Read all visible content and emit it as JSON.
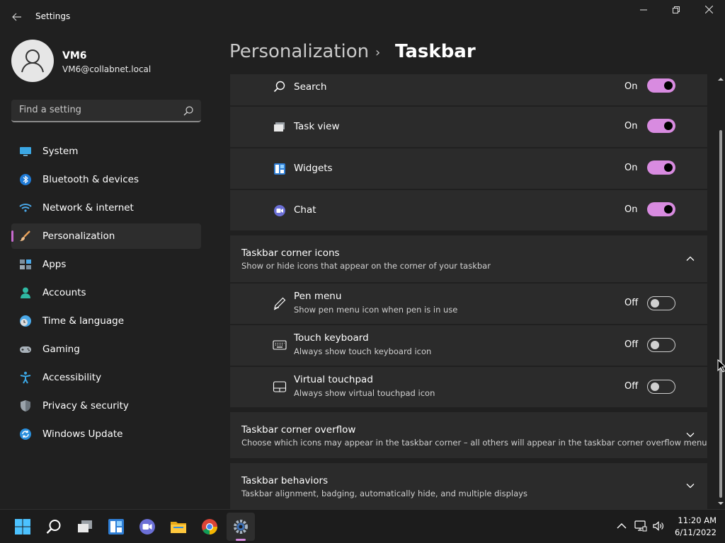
{
  "window": {
    "title": "Settings",
    "back_icon": "arrow-left-icon",
    "minimize_icon": "minimize-icon",
    "maximize_icon": "restore-icon",
    "close_icon": "close-icon"
  },
  "profile": {
    "name": "VM6",
    "email": "VM6@collabnet.local",
    "avatar_icon": "person-icon"
  },
  "search": {
    "placeholder": "Find a setting",
    "icon": "search-icon"
  },
  "sidebar": {
    "items": [
      {
        "label": "System",
        "icon": "monitor-icon"
      },
      {
        "label": "Bluetooth & devices",
        "icon": "bluetooth-icon"
      },
      {
        "label": "Network & internet",
        "icon": "wifi-icon"
      },
      {
        "label": "Personalization",
        "icon": "brush-icon"
      },
      {
        "label": "Apps",
        "icon": "apps-icon"
      },
      {
        "label": "Accounts",
        "icon": "person-icon"
      },
      {
        "label": "Time & language",
        "icon": "clock-globe-icon"
      },
      {
        "label": "Gaming",
        "icon": "gamepad-icon"
      },
      {
        "label": "Accessibility",
        "icon": "accessibility-icon"
      },
      {
        "label": "Privacy & security",
        "icon": "shield-icon"
      },
      {
        "label": "Windows Update",
        "icon": "update-icon"
      }
    ],
    "selected": "Personalization"
  },
  "header": {
    "parent": "Personalization",
    "separator": "›",
    "current": "Taskbar"
  },
  "taskbar_items": [
    {
      "title": "Search",
      "state": "On",
      "icon": "search-icon"
    },
    {
      "title": "Task view",
      "state": "On",
      "icon": "task-view-icon"
    },
    {
      "title": "Widgets",
      "state": "On",
      "icon": "widgets-icon"
    },
    {
      "title": "Chat",
      "state": "On",
      "icon": "chat-icon"
    }
  ],
  "corner_icons": {
    "title": "Taskbar corner icons",
    "subtitle": "Show or hide icons that appear on the corner of your taskbar",
    "icon": "chevron-up-icon",
    "items": [
      {
        "title": "Pen menu",
        "subtitle": "Show pen menu icon when pen is in use",
        "state": "Off",
        "icon": "pen-icon"
      },
      {
        "title": "Touch keyboard",
        "subtitle": "Always show touch keyboard icon",
        "state": "Off",
        "icon": "keyboard-icon"
      },
      {
        "title": "Virtual touchpad",
        "subtitle": "Always show virtual touchpad icon",
        "state": "Off",
        "icon": "touchpad-icon"
      }
    ]
  },
  "corner_overflow": {
    "title": "Taskbar corner overflow",
    "subtitle": "Choose which icons may appear in the taskbar corner – all others will appear in the taskbar corner overflow menu",
    "icon": "chevron-down-icon"
  },
  "behaviors": {
    "title": "Taskbar behaviors",
    "subtitle": "Taskbar alignment, badging, automatically hide, and multiple displays",
    "icon": "chevron-down-icon"
  },
  "system_taskbar": {
    "apps": [
      "start-icon",
      "search-icon",
      "task-view-icon",
      "widgets-icon",
      "chat-icon",
      "file-explorer-icon",
      "chrome-icon",
      "settings-icon"
    ],
    "active_app": "settings-icon",
    "tray": [
      "chevron-up-icon",
      "network-icon",
      "volume-icon"
    ],
    "time": "11:20 AM",
    "date": "6/11/2022"
  },
  "colors": {
    "background": "#202020",
    "card": "#2b2b2b",
    "accent": "#d88be0",
    "text": "#ffffff"
  }
}
